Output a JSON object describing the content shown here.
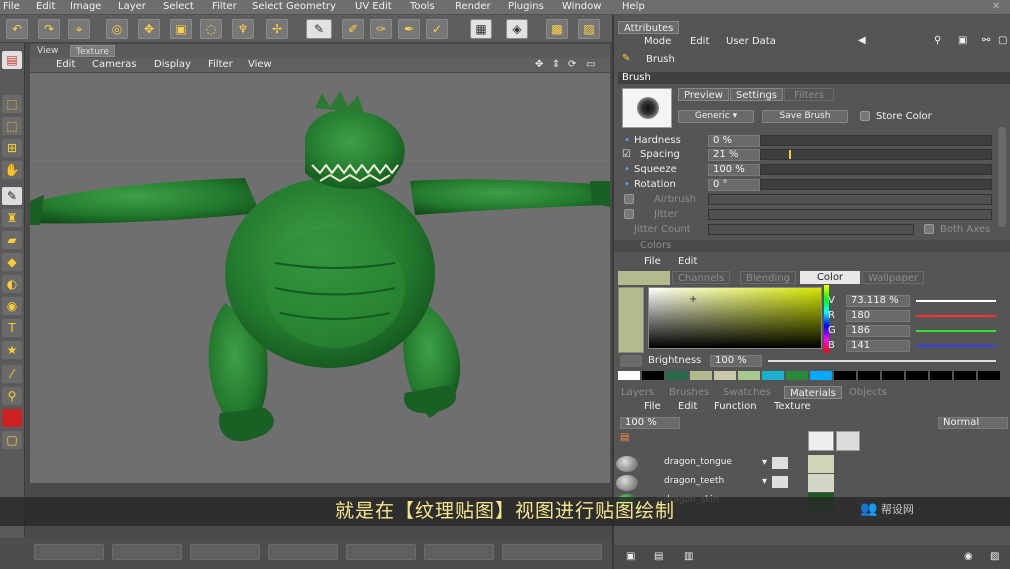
{
  "menubar": [
    "File",
    "Edit",
    "Image",
    "Layer",
    "Select",
    "Filter",
    "Select Geometry",
    "UV Edit",
    "Tools",
    "Render",
    "Plugins",
    "Window",
    "Help"
  ],
  "view": {
    "tabs": [
      "View",
      "Texture"
    ],
    "menu": [
      "Edit",
      "Cameras",
      "Display",
      "Filter",
      "View"
    ]
  },
  "attributes": {
    "tab": "Attributes",
    "menu": [
      "Mode",
      "Edit",
      "User Data"
    ],
    "tool": "Brush",
    "brush_section": "Brush",
    "brush_tabs": [
      "Preview",
      "Settings",
      "Filters"
    ],
    "preset": "Generic",
    "save_brush": "Save Brush",
    "store_color": "Store Color",
    "params": [
      {
        "label": "Hardness",
        "value": "0 %",
        "fill": 0.0
      },
      {
        "label": "Spacing",
        "value": "21 %",
        "fill": 0.12
      },
      {
        "label": "Squeeze",
        "value": "100 %",
        "fill": 0.0
      },
      {
        "label": "Rotation",
        "value": "0 °",
        "fill": 0.0
      },
      {
        "label": "Airbrush",
        "value": "",
        "fill": 0.0
      },
      {
        "label": "Jitter",
        "value": "",
        "fill": 0.0
      },
      {
        "label": "Jitter Count",
        "value": "",
        "fill": 0.0
      }
    ],
    "both_axes": "Both Axes"
  },
  "color": {
    "section": "Colors",
    "menu": [
      "File",
      "Edit"
    ],
    "tabs": [
      "Channels",
      "Blending",
      "Color",
      "Wallpaper"
    ],
    "channels": [
      {
        "label": "V",
        "value": "73.118 %",
        "fill": 0.73,
        "color": "#ffffff"
      },
      {
        "label": "R",
        "value": "180",
        "fill": 0.7,
        "color": "#ff3030"
      },
      {
        "label": "G",
        "value": "186",
        "fill": 0.73,
        "color": "#30e030"
      },
      {
        "label": "B",
        "value": "141",
        "fill": 0.55,
        "color": "#3040ff"
      }
    ],
    "brightness_label": "Brightness",
    "brightness_value": "100 %",
    "current_color": "#b4ba8d",
    "swatches": [
      "#ffffff",
      "#000000",
      "#2a6a4a",
      "#b4ba8d",
      "#c8c8a8",
      "#a8c890",
      "#1ab0d0",
      "#2a8a3a",
      "#00aaff",
      "#000000",
      "#000000",
      "#000000",
      "#000000",
      "#000000",
      "#000000",
      "#000000"
    ]
  },
  "materials": {
    "tabs": [
      "Layers",
      "Brushes",
      "Swatches",
      "Materials",
      "Objects"
    ],
    "menu": [
      "File",
      "Edit",
      "Function",
      "Texture"
    ],
    "opacity": "100 %",
    "blend_mode": "Normal",
    "items": [
      {
        "name": "dragon_tongue"
      },
      {
        "name": "dragon_teeth"
      },
      {
        "name": "dragon_skin"
      }
    ]
  },
  "subtitle": "就是在【纹理贴图】视图进行贴图绘制",
  "watermark": "帮设网"
}
